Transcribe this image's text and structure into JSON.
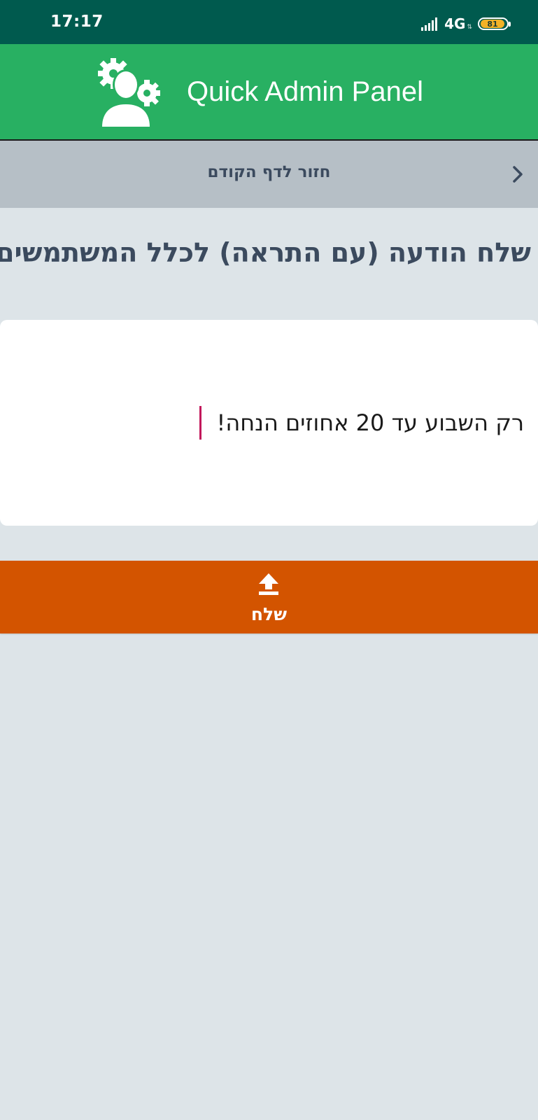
{
  "status_bar": {
    "time": "17:17",
    "network": "4G",
    "battery_level": "81",
    "background_color": "#005a4e",
    "battery_color": "#f3b227"
  },
  "header": {
    "title": "Quick Admin Panel",
    "logo_icon": "admin-gears-user-icon",
    "background_color": "#28b062"
  },
  "back_bar": {
    "label": "חזור לדף הקודם",
    "icon": "chevron-right-icon",
    "background_color": "#b6bfc6"
  },
  "page": {
    "title": "שלח הודעה (עם התראה) לכלל המשתמשים"
  },
  "message_field": {
    "value": "רק השבוע עד 20 אחוזים הנחה!",
    "caret_color": "#c2185b"
  },
  "send_button": {
    "label": "שלח",
    "icon": "upload-icon",
    "background_color": "#d35400"
  }
}
